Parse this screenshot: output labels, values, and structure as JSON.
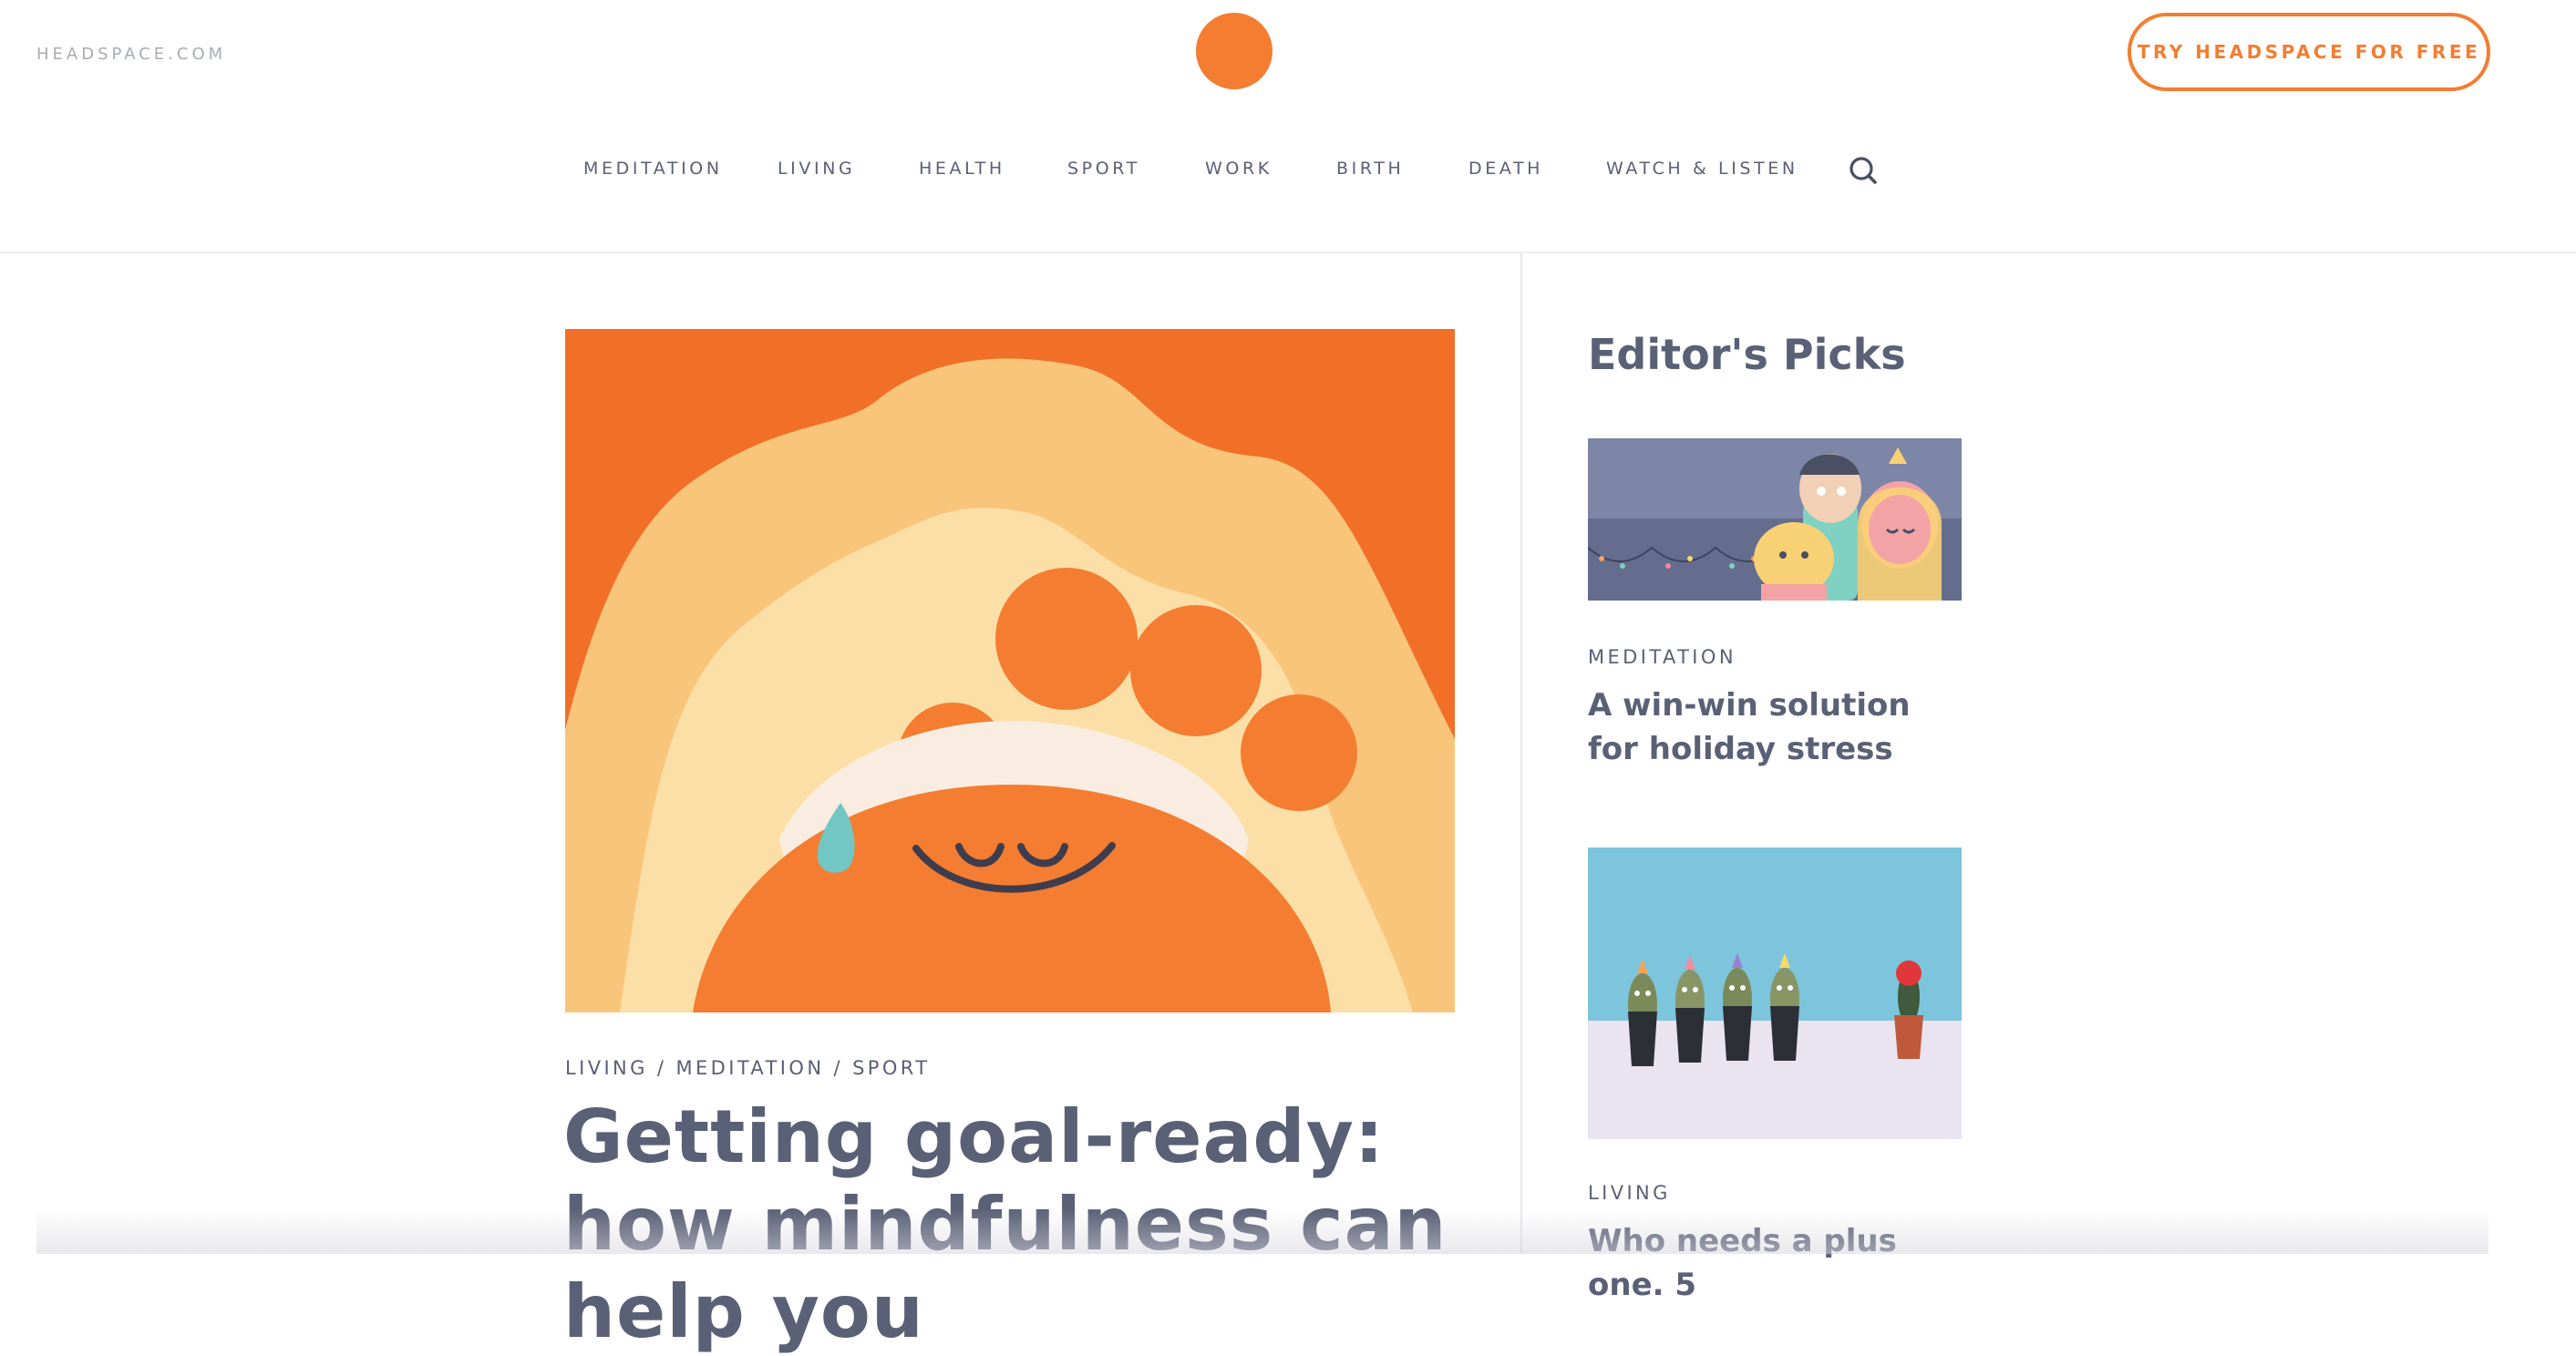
{
  "header": {
    "site_link": "HEADSPACE.COM",
    "logo": "headspace-orange-dot-logo",
    "cta_label": "TRY HEADSPACE FOR FREE"
  },
  "nav": {
    "items": [
      {
        "label": "MEDITATION"
      },
      {
        "label": "LIVING"
      },
      {
        "label": "HEALTH"
      },
      {
        "label": "SPORT"
      },
      {
        "label": "WORK"
      },
      {
        "label": "BIRTH"
      },
      {
        "label": "DEATH"
      },
      {
        "label": "WATCH & LISTEN"
      }
    ],
    "search_icon": "search-icon"
  },
  "article": {
    "tags": [
      "LIVING",
      "MEDITATION",
      "SPORT"
    ],
    "tag_separator": " / ",
    "title": "Getting goal-ready: how mindfulness can help you",
    "image": "orange-character-with-headband-illustration"
  },
  "sidebar": {
    "heading": "Editor's Picks",
    "picks": [
      {
        "category": "MEDITATION",
        "title": "A win-win solution for holiday stress",
        "image": "family-hug-holiday-lights-illustration"
      },
      {
        "category": "LIVING",
        "title": "Who needs a plus one. 5",
        "image": "party-hat-cacti-photo"
      }
    ]
  },
  "colors": {
    "brand_orange": "#f47d31",
    "text": "#5a6076",
    "muted": "#a8abb4"
  }
}
